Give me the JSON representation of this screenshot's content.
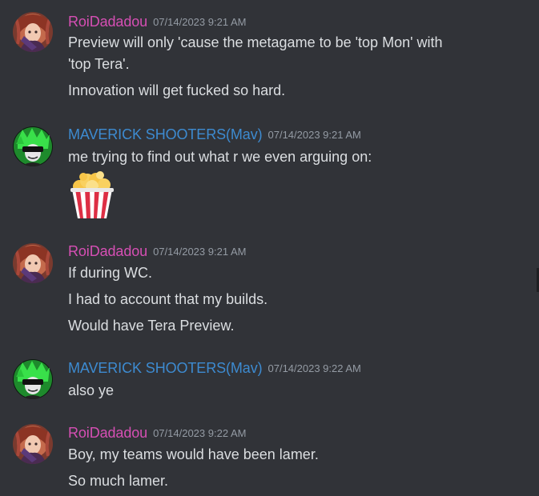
{
  "colors": {
    "background": "#313338",
    "roi_name": "#d64fb4",
    "mav_name": "#3d8bd1",
    "message_text": "#dbdee1",
    "timestamp": "#949ba4"
  },
  "messages": [
    {
      "author": "RoiDadadou",
      "timestamp": "07/14/2023 9:21 AM",
      "avatar_icon": "roidadadou-avatar",
      "lines": [
        "Preview will only 'cause the metagame to be 'top Mon' with",
        "'top Tera'.",
        "Innovation will get fucked so hard."
      ]
    },
    {
      "author": "MAVERICK SHOOTERS(Mav)",
      "timestamp": "07/14/2023 9:21 AM",
      "avatar_icon": "maverick-avatar",
      "lines": [
        "me trying to find out what r we even arguing on:"
      ],
      "attachment_icon": "popcorn-emoji"
    },
    {
      "author": "RoiDadadou",
      "timestamp": "07/14/2023 9:21 AM",
      "avatar_icon": "roidadadou-avatar",
      "lines": [
        "If during WC.",
        "I had to account that my builds.",
        "Would have Tera Preview."
      ]
    },
    {
      "author": "MAVERICK SHOOTERS(Mav)",
      "timestamp": "07/14/2023 9:22 AM",
      "avatar_icon": "maverick-avatar",
      "lines": [
        "also ye"
      ]
    },
    {
      "author": "RoiDadadou",
      "timestamp": "07/14/2023 9:22 AM",
      "avatar_icon": "roidadadou-avatar",
      "lines": [
        "Boy, my teams would have been lamer.",
        "So much lamer."
      ]
    }
  ]
}
